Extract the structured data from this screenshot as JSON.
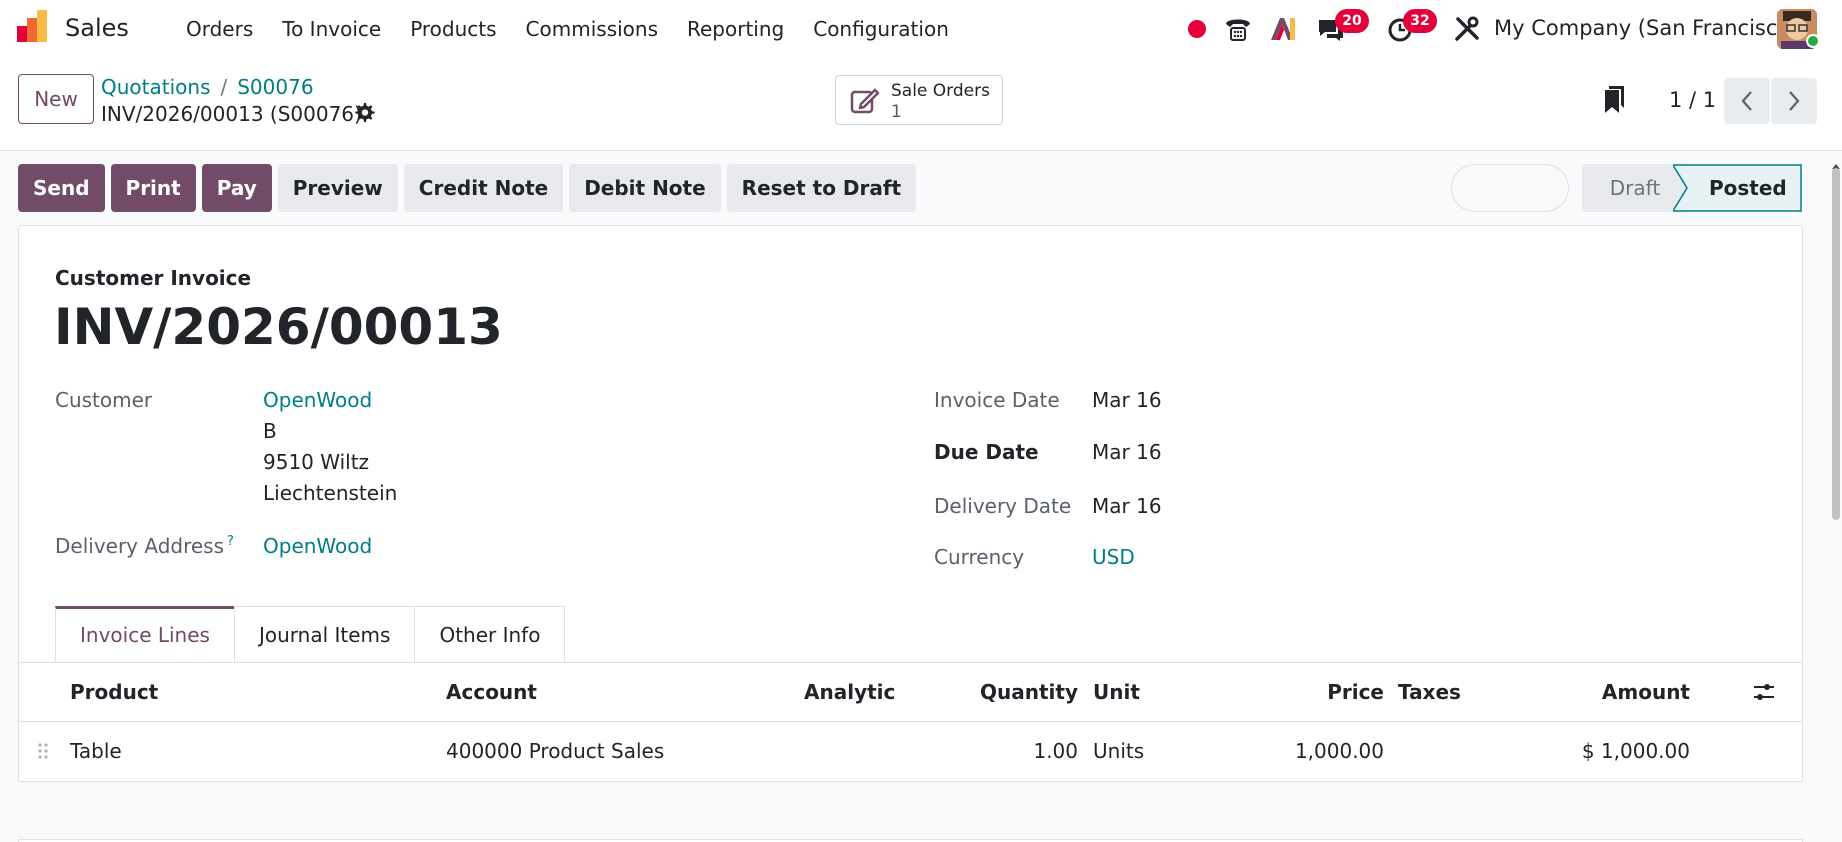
{
  "navbar": {
    "app_name": "Sales",
    "menu": [
      "Orders",
      "To Invoice",
      "Products",
      "Commissions",
      "Reporting",
      "Configuration"
    ],
    "messages_badge": "20",
    "activities_badge": "32",
    "company": "My Company (San Francisco)"
  },
  "control": {
    "new_label": "New",
    "breadcrumbs": [
      "Quotations",
      "S00076"
    ],
    "breadcrumb_sep": "/",
    "current_title": "INV/2026/00013 (S00076)",
    "smart_button": {
      "label": "Sale Orders",
      "value": "1"
    },
    "pager": "1 / 1"
  },
  "actions": {
    "send": "Send",
    "print": "Print",
    "pay": "Pay",
    "preview": "Preview",
    "credit_note": "Credit Note",
    "debit_note": "Debit Note",
    "reset_to_draft": "Reset to Draft"
  },
  "status": {
    "draft": "Draft",
    "posted": "Posted",
    "current": "Posted"
  },
  "invoice": {
    "type": "Customer Invoice",
    "number": "INV/2026/00013",
    "customer_label": "Customer",
    "customer_name": "OpenWood",
    "address_lines": [
      "B",
      "9510 Wiltz",
      "Liechtenstein"
    ],
    "delivery_address_label": "Delivery Address",
    "delivery_address_help": "?",
    "delivery_address": "OpenWood",
    "invoice_date_label": "Invoice Date",
    "invoice_date": "Mar 16",
    "due_date_label": "Due Date",
    "due_date": "Mar 16",
    "delivery_date_label": "Delivery Date",
    "delivery_date": "Mar 16",
    "currency_label": "Currency",
    "currency": "USD"
  },
  "tabs": [
    "Invoice Lines",
    "Journal Items",
    "Other Info"
  ],
  "lines": {
    "headers": {
      "product": "Product",
      "account": "Account",
      "analytic": "Analytic",
      "quantity": "Quantity",
      "unit": "Unit",
      "price": "Price",
      "taxes": "Taxes",
      "amount": "Amount"
    },
    "rows": [
      {
        "product": "Table",
        "account": "400000 Product Sales",
        "analytic": "",
        "quantity": "1.00",
        "unit": "Units",
        "price": "1,000.00",
        "taxes": "",
        "amount": "$ 1,000.00"
      }
    ]
  },
  "colors": {
    "brand": "#714b67",
    "link": "#017e84",
    "badge": "#e4003a"
  }
}
